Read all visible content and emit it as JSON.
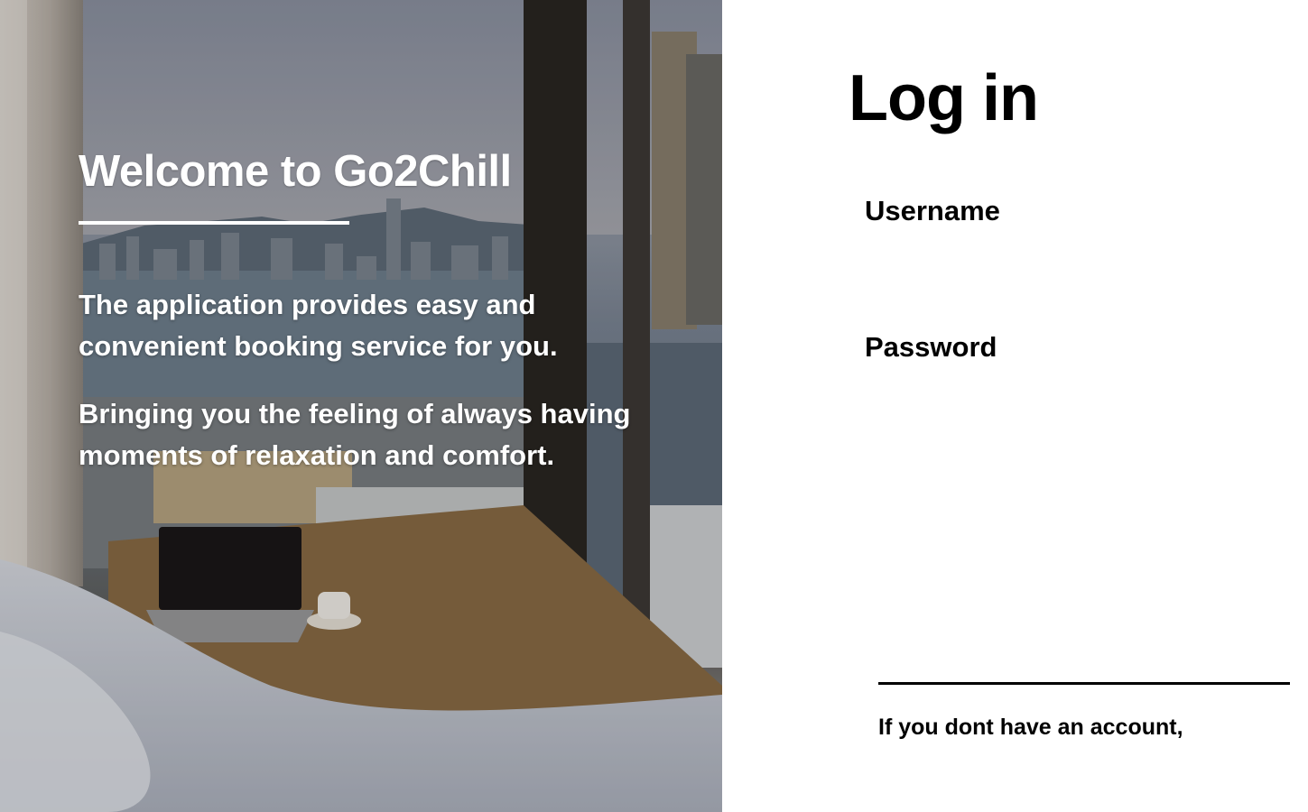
{
  "hero": {
    "title": "Welcome to Go2Chill",
    "paragraph_1": "The application provides easy and convenient booking service for you.",
    "paragraph_2": "Bringing you the feeling of always having moments of relaxation and comfort."
  },
  "login": {
    "title": "Log in",
    "username_label": "Username",
    "username_value": "",
    "password_label": "Password",
    "password_value": "",
    "signup_prompt": "If you dont have an account,"
  },
  "colors": {
    "text_primary": "#000000",
    "hero_text": "#ffffff",
    "background": "#ffffff"
  }
}
